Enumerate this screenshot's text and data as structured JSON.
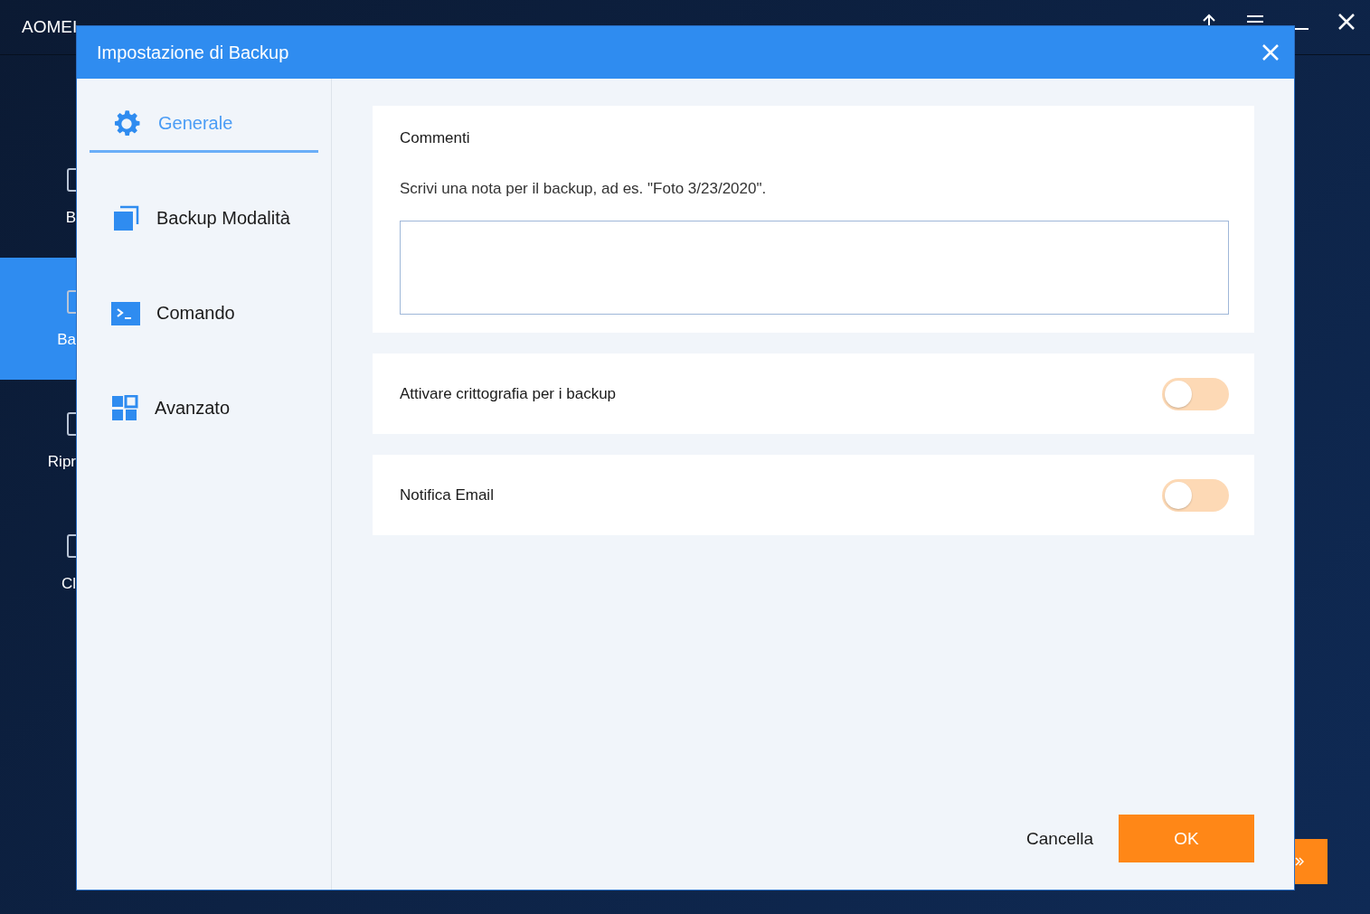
{
  "app": {
    "title": "AOMEI",
    "nav": [
      {
        "label": "B",
        "selected": false
      },
      {
        "label": "Ba",
        "selected": true
      },
      {
        "label": "Ripr",
        "selected": false
      },
      {
        "label": "Cl",
        "selected": false
      }
    ]
  },
  "dialog": {
    "title": "Impostazione di Backup",
    "sidebar": [
      {
        "label": "Generale",
        "kind": "gear",
        "selected": true
      },
      {
        "label": "Backup Modalità",
        "kind": "copy",
        "selected": false
      },
      {
        "label": "Comando",
        "kind": "terminal",
        "selected": false
      },
      {
        "label": "Avanzato",
        "kind": "grid",
        "selected": false
      }
    ],
    "comments": {
      "heading": "Commenti",
      "hint": "Scrivi una nota per il backup, ad es. \"Foto 3/23/2020\"."
    },
    "toggles": [
      {
        "label": "Attivare crittografia per i backup",
        "on": false
      },
      {
        "label": "Notifica Email",
        "on": false
      }
    ],
    "buttons": {
      "cancel": "Cancella",
      "ok": "OK"
    }
  }
}
